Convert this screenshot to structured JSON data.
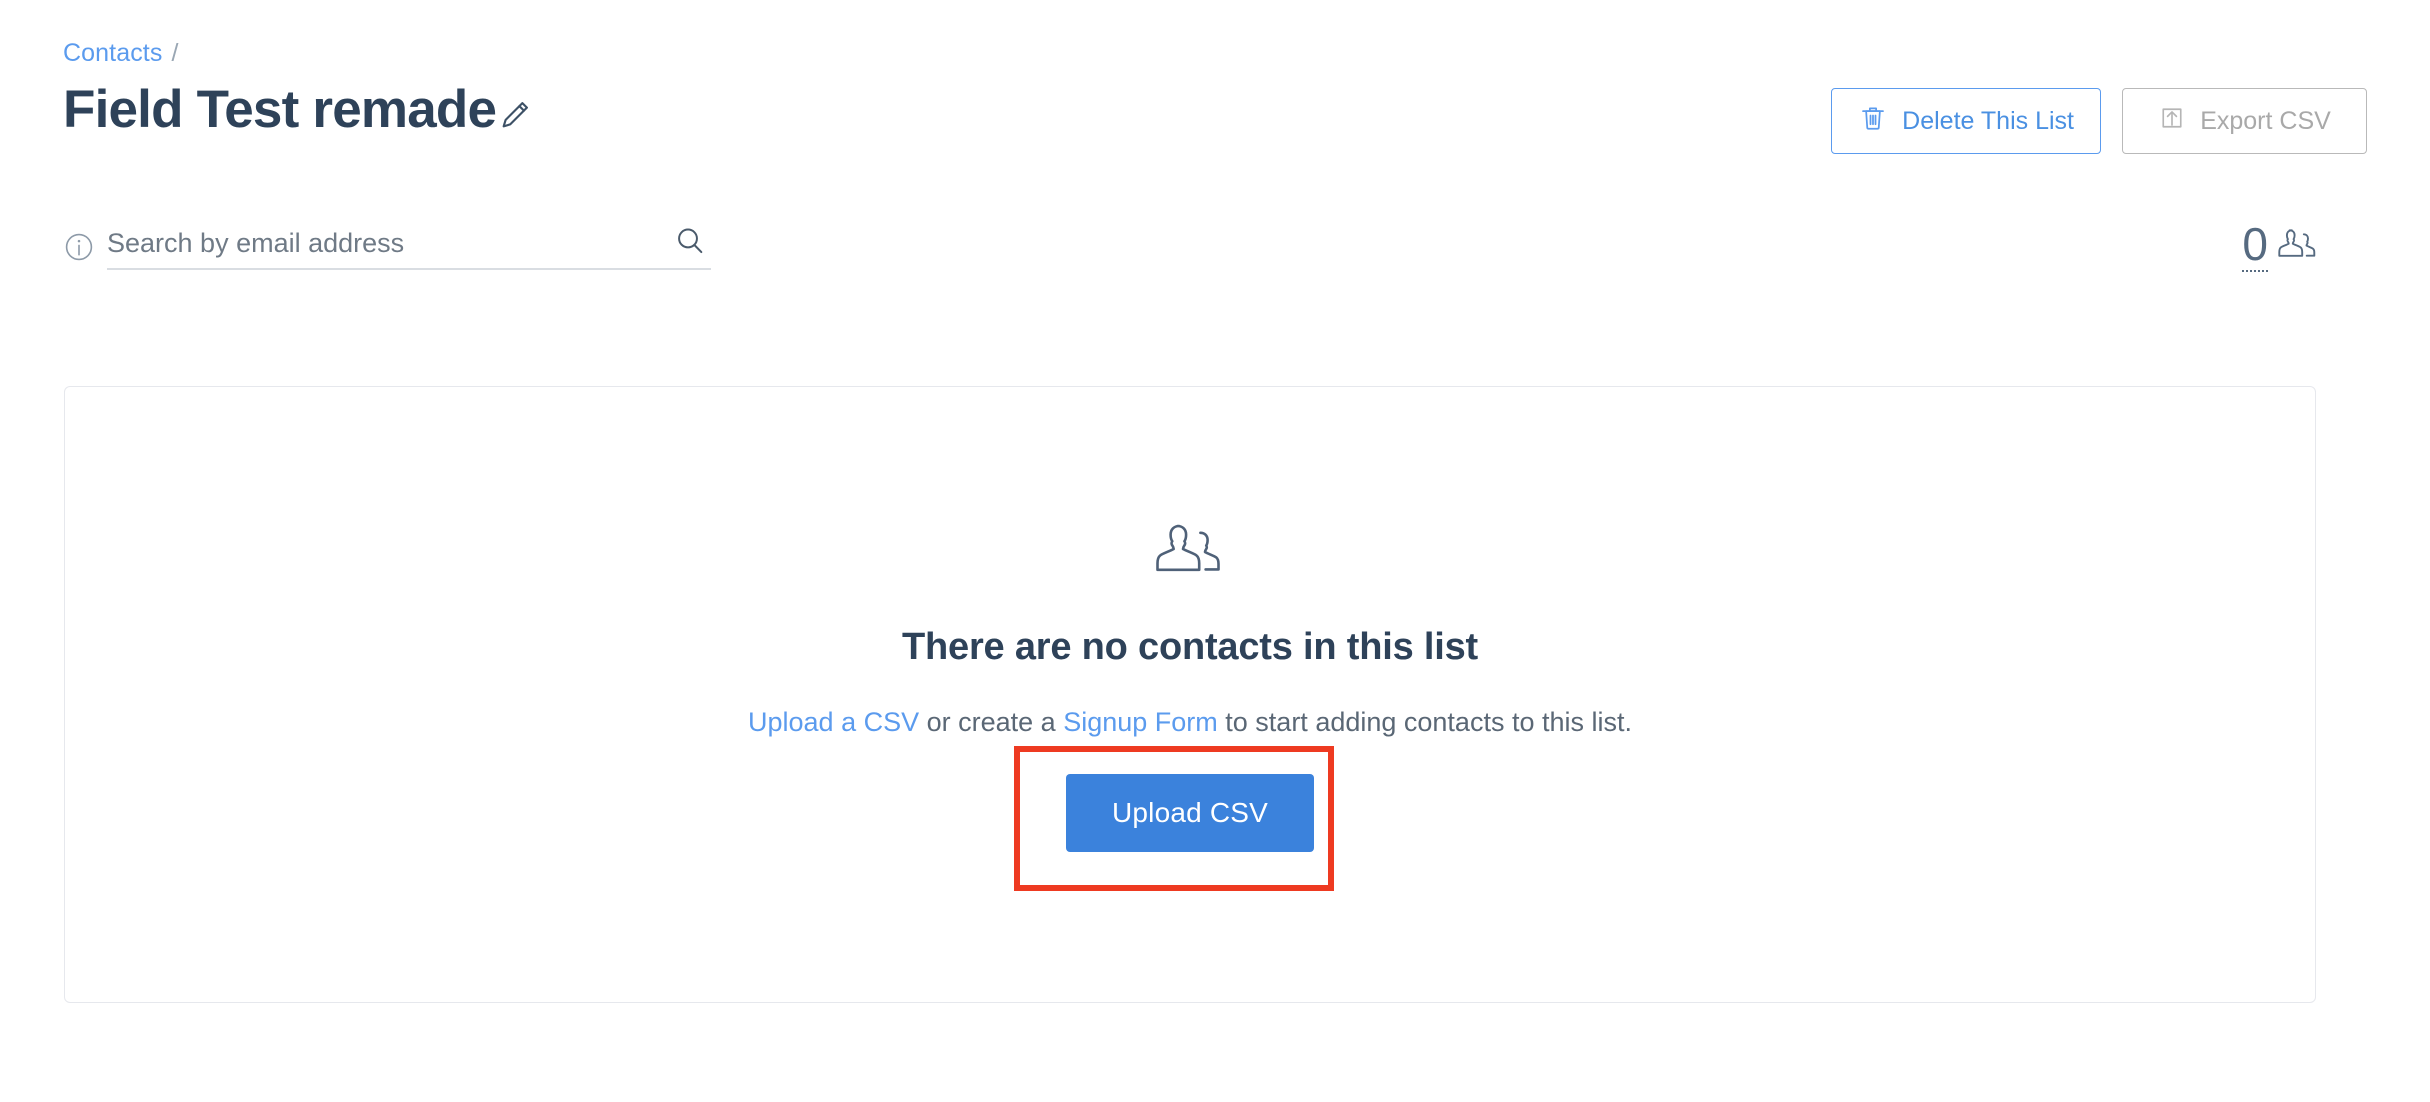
{
  "breadcrumb": {
    "parent_label": "Contacts",
    "separator": "/"
  },
  "header": {
    "title": "Field Test remade",
    "edit_icon": "pencil-icon"
  },
  "top_actions": {
    "delete_list": {
      "label": "Delete This List",
      "icon": "trash-icon",
      "color": "#4a90e2",
      "enabled": true
    },
    "export_csv": {
      "label": "Export CSV",
      "icon": "upload-box-icon",
      "color": "#a9a9a9",
      "enabled": false
    }
  },
  "search": {
    "placeholder": "Search by email address",
    "value": "",
    "info_icon": "info-circle-icon",
    "search_icon": "search-icon"
  },
  "contact_count": {
    "value": "0",
    "icon": "people-icon"
  },
  "empty_state": {
    "icon": "people-outline-icon",
    "title": "There are no contacts in this list",
    "description_parts": {
      "link_upload": "Upload a CSV",
      "text_middle_1": " or create a ",
      "link_signup": "Signup Form",
      "text_middle_2": " to start adding contacts to this list."
    },
    "primary_button": {
      "label": "Upload CSV",
      "color": "#3b82dc"
    },
    "highlight_color": "#ee3a21"
  }
}
